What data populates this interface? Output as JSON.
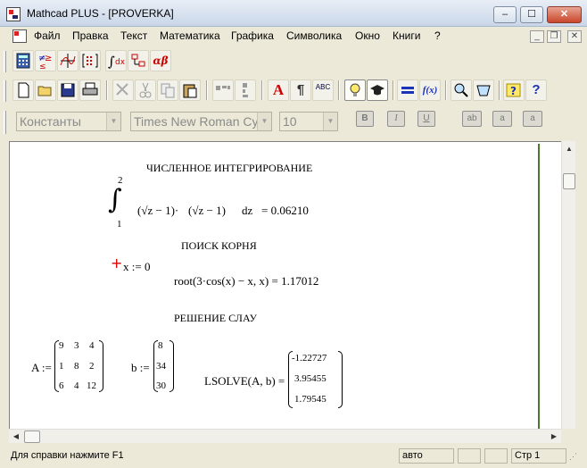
{
  "window": {
    "title": "Mathcad PLUS - [PROVERKA]",
    "buttons": {
      "minimize": "–",
      "maximize": "☐",
      "close": "✕"
    }
  },
  "menu": {
    "items": [
      "Файл",
      "Правка",
      "Текст",
      "Математика",
      "Графика",
      "Символика",
      "Окно",
      "Книги",
      "?"
    ],
    "mdi": {
      "minimize": "_",
      "restore": "❐",
      "close": "✕"
    }
  },
  "math_palette": {
    "buttons": [
      "calculator-icon",
      "boolean-icon",
      "graph-icon",
      "matrix-icon",
      "calculus-icon",
      "programming-icon"
    ],
    "greek_label": "αβ"
  },
  "standard_toolbar": {
    "buttons": [
      "new-icon",
      "open-icon",
      "save-icon",
      "print-icon",
      "check-icon",
      "cut-icon",
      "copy-icon",
      "paste-icon",
      "align-h-icon",
      "align-v-icon",
      "text-icon",
      "paragraph-icon",
      "spell-icon",
      "bulb-icon",
      "resource-icon",
      "equal-icon",
      "function-icon",
      "zoom-icon",
      "calc-icon",
      "quicksheet-icon",
      "help-icon"
    ],
    "labels": {
      "text": "A",
      "paragraph": "¶",
      "spell": "ABC",
      "function": "f(x)",
      "help": "?"
    }
  },
  "format_bar": {
    "style_value": "Константы",
    "font_value": "Times New Roman Cyr",
    "size_value": "10",
    "bold": "B",
    "italic": "I",
    "underline": "U",
    "sub": "ab",
    "sup1": "a",
    "sup2": "a"
  },
  "document": {
    "section1_title": "ЧИСЛЕННОЕ ИНТЕГРИРОВАНИЕ",
    "integral": {
      "upper": "2",
      "lower": "1",
      "integrand_a": "√z − 1",
      "integrand_b": "√z − 1",
      "dz": "dz",
      "result": "= 0.06210"
    },
    "section2_title": "ПОИСК КОРНЯ",
    "x_assign": "x := 0",
    "root_expr": "root(3·cos(x) − x, x) = 1.17012",
    "section3_title": "РЕШЕНИЕ СЛАУ",
    "A_label": "A :=",
    "A_matrix": [
      [
        "9",
        "3",
        "4"
      ],
      [
        "1",
        "8",
        "2"
      ],
      [
        "6",
        "4",
        "12"
      ]
    ],
    "b_label": "b :=",
    "b_vector": [
      "8",
      "34",
      "30"
    ],
    "lsolve_label": "LSOLVE(A, b) =",
    "lsolve_result": [
      "-1.22727",
      "3.95455",
      "1.79545"
    ]
  },
  "statusbar": {
    "help_text": "Для справки нажмите F1",
    "mode": "авто",
    "page": "Стр 1"
  }
}
